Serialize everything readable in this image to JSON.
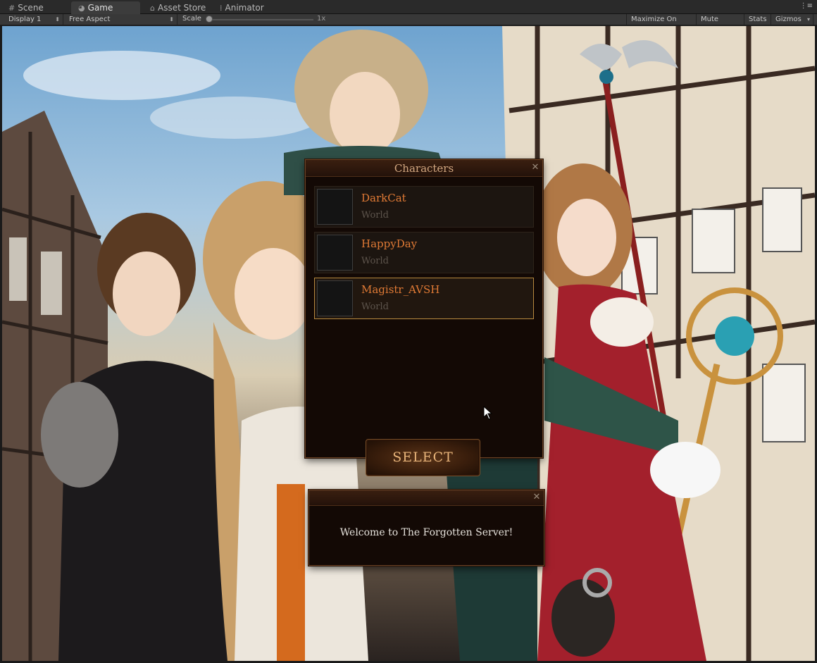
{
  "editor": {
    "tabs": [
      {
        "label": "Scene",
        "icon": "grid-icon"
      },
      {
        "label": "Game",
        "icon": "pacman-icon"
      },
      {
        "label": "Asset Store",
        "icon": "bag-icon"
      },
      {
        "label": "Animator",
        "icon": "animator-icon"
      }
    ],
    "active_tab": "Game",
    "toolbar": {
      "display": "Display 1",
      "aspect": "Free Aspect",
      "scale_label": "Scale",
      "scale_value": "1x",
      "maximize_on_play": "Maximize On Play",
      "mute_audio": "Mute Audio",
      "stats": "Stats",
      "gizmos": "Gizmos"
    }
  },
  "characters_window": {
    "title": "Characters",
    "characters": [
      {
        "name": "DarkCat",
        "world": "World"
      },
      {
        "name": "HappyDay",
        "world": "World"
      },
      {
        "name": "Magistr_AVSH",
        "world": "World"
      }
    ],
    "selected_index": 2,
    "select_button": "SELECT"
  },
  "message_window": {
    "text": "Welcome to The Forgotten Server!"
  },
  "colors": {
    "accent_name": "#e07a35",
    "window_bg": "#130905",
    "window_border": "#6b4326",
    "selected_border": "#b88a3e"
  }
}
